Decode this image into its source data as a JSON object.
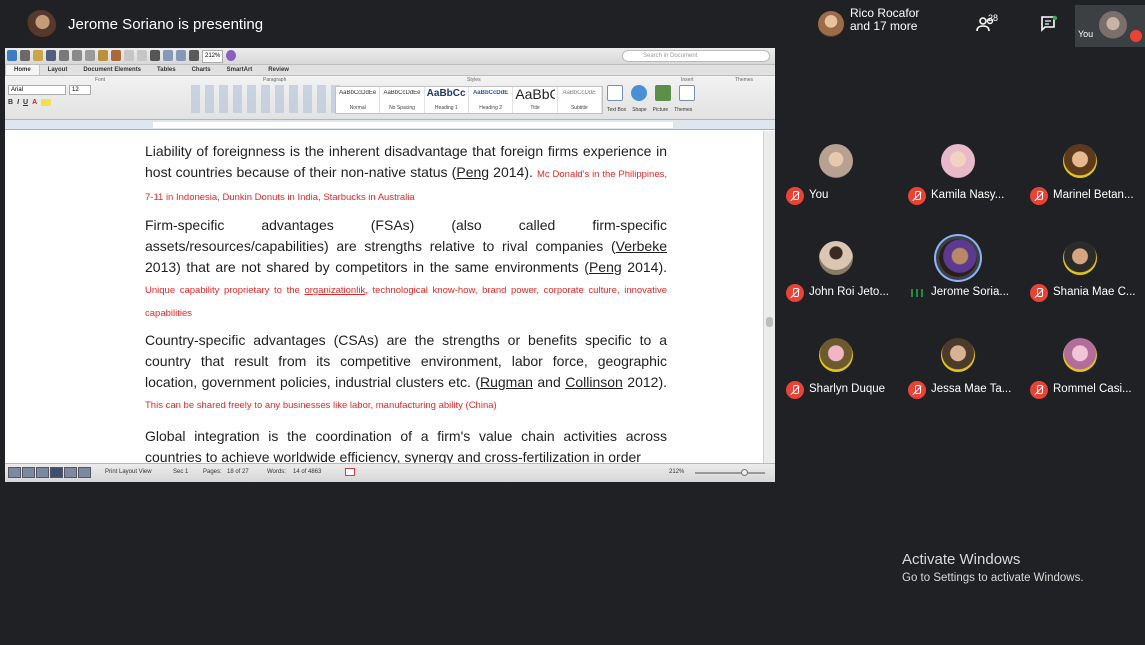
{
  "meeting": {
    "presenter_title": "Jerome Soriano is presenting",
    "top_participant_line1": "Rico Rocafor",
    "top_participant_line2": "and 17 more",
    "participant_count": "28",
    "self_label": "You"
  },
  "word": {
    "search_placeholder": "Search in Document",
    "tabs": [
      "Home",
      "Layout",
      "Document Elements",
      "Tables",
      "Charts",
      "SmartArt",
      "Review"
    ],
    "groups": {
      "font": "Font",
      "paragraph": "Paragraph",
      "styles": "Styles",
      "insert": "Insert",
      "themes": "Themes"
    },
    "font_name": "Arial",
    "font_size": "12",
    "zoom_box": "212%",
    "styles": [
      {
        "sample": "AaBbCcDdEe",
        "name": "Normal"
      },
      {
        "sample": "AaBbCcDdEe",
        "name": "No Spacing"
      },
      {
        "sample": "AaBbCcDc",
        "name": "Heading 1"
      },
      {
        "sample": "AaBbCcDdE",
        "name": "Heading 2"
      },
      {
        "sample": "AaBbC",
        "name": "Title"
      },
      {
        "sample": "AaBbCcDdE",
        "name": "Subtitle"
      }
    ],
    "insert_labels": [
      "Text Box",
      "Shape",
      "Picture",
      "Themes"
    ],
    "status": {
      "view": "Print Layout View",
      "sec": "Sec    1",
      "pages_label": "Pages:",
      "pages": "18 of 27",
      "words_label": "Words:",
      "words": "14 of 4863",
      "zoom": "212%"
    }
  },
  "document": {
    "p1_text": "Liability of foreignness is the inherent disadvantage that foreign firms experience in host countries because of their non-native status (",
    "p1_cite": "Peng",
    "p1_after": " 2014). ",
    "p1_note": "Mc Donald's in the Philippines, 7-11 in Indonesia, Dunkin Donuts in India, Starbucks in Australia",
    "p2_text": "Firm-specific advantages (FSAs) (also called firm-specific assets/resources/capabilities) are strengths relative to rival companies (",
    "p2_cite1": "Verbeke",
    "p2_mid": " 2013) that are not shared by competitors in the same environments (",
    "p2_cite2": "Peng",
    "p2_end": " 2014).",
    "p2_note_a": "Unique capability proprietary to the ",
    "p2_note_link": "organizationlik",
    "p2_note_b": ", technological know-how, brand power, corporate culture, innovative capabilities",
    "p3_text": "Country-specific advantages (CSAs) are the strengths or benefits specific to a country that result from its competitive environment, labor force, geographic location, government policies, industrial clusters etc. (",
    "p3_cite1": "Rugman",
    "p3_and": " and ",
    "p3_cite2": "Collinson",
    "p3_end": " 2012). ",
    "p3_note": "This can be shared freely to any businesses like labor, manufacturing ability (China)",
    "p4_text": "Global integration is the coordination of a firm's value chain activities across countries to achieve worldwide efficiency, synergy and cross-fertilization in order"
  },
  "participants": [
    {
      "name": "You",
      "muted": true
    },
    {
      "name": "Kamila Nasy...",
      "muted": true
    },
    {
      "name": "Marinel Betan...",
      "muted": true
    },
    {
      "name": "John Roi Jeto...",
      "muted": true
    },
    {
      "name": "Jerome Soria...",
      "muted": false
    },
    {
      "name": "Shania Mae C...",
      "muted": true
    },
    {
      "name": "Sharlyn Duque",
      "muted": true
    },
    {
      "name": "Jessa Mae Ta...",
      "muted": true
    },
    {
      "name": "Rommel Casi...",
      "muted": true
    }
  ],
  "watermark": {
    "line1": "Activate Windows",
    "line2": "Go to Settings to activate Windows."
  }
}
